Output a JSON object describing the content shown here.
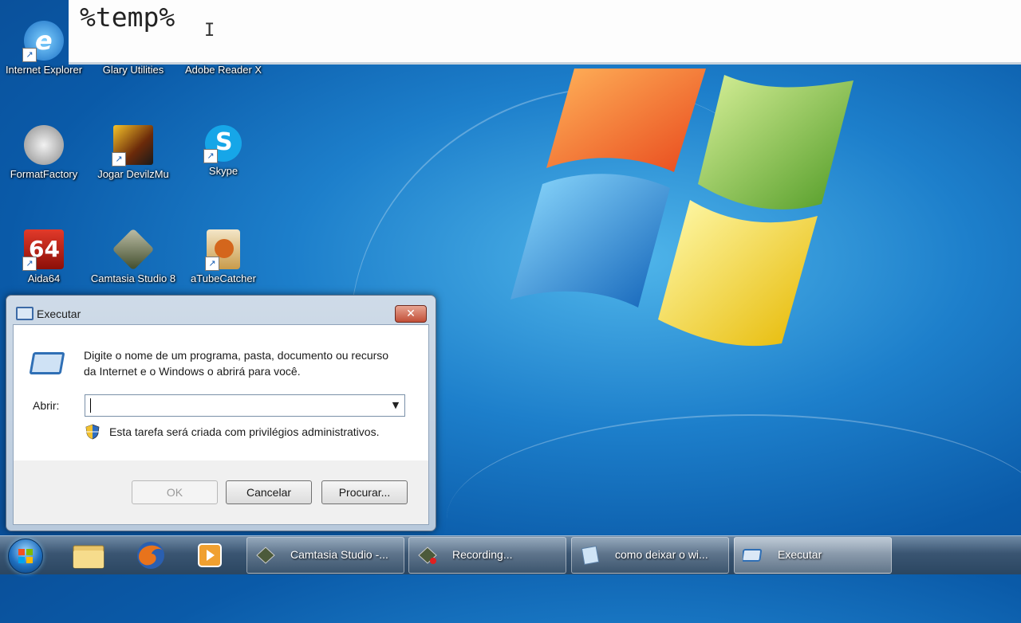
{
  "overlay": {
    "typed_text": "%temp%",
    "cursor_glyph": "I"
  },
  "desktop_icons": [
    {
      "label": "Internet Explorer",
      "icon": "internet-explorer-icon"
    },
    {
      "label": "Glary Utilities",
      "icon": "glary-utilities-icon"
    },
    {
      "label": "Adobe Reader X",
      "icon": "adobe-reader-icon"
    },
    {
      "label": "FormatFactory",
      "icon": "formatfactory-icon"
    },
    {
      "label": "Jogar DevilzMu",
      "icon": "devilzmu-icon"
    },
    {
      "label": "Skype",
      "icon": "skype-icon"
    },
    {
      "label": "Aida64",
      "icon": "aida64-icon",
      "glyph_text": "64"
    },
    {
      "label": "Camtasia Studio 8",
      "icon": "camtasia-icon"
    },
    {
      "label": "aTubeCatcher",
      "icon": "atubecatcher-icon"
    }
  ],
  "dialog": {
    "title": "Executar",
    "close_glyph": "✕",
    "description": "Digite o nome de um programa, pasta, documento ou recurso da Internet e o Windows o abrirá para você.",
    "open_label": "Abrir:",
    "open_value": "",
    "admin_note": "Esta tarefa será criada com privilégios administrativos.",
    "ok_label": "OK",
    "cancel_label": "Cancelar",
    "browse_label": "Procurar..."
  },
  "taskbar": {
    "pinned": [
      "file-explorer-icon",
      "firefox-icon",
      "media-player-icon"
    ],
    "tasks": [
      {
        "label": "Camtasia Studio -...",
        "icon": "camtasia-icon",
        "active": false
      },
      {
        "label": "Recording...",
        "icon": "recording-icon",
        "active": false
      },
      {
        "label": "como deixar o wi...",
        "icon": "notepad-icon",
        "active": false
      },
      {
        "label": "Executar",
        "icon": "run-icon",
        "active": true
      }
    ]
  },
  "colors": {
    "desktop": "#1d7fcb",
    "taskbar": "#3a5572",
    "dialog_frame": "#b8c9dc",
    "close_button": "#c14f38"
  }
}
